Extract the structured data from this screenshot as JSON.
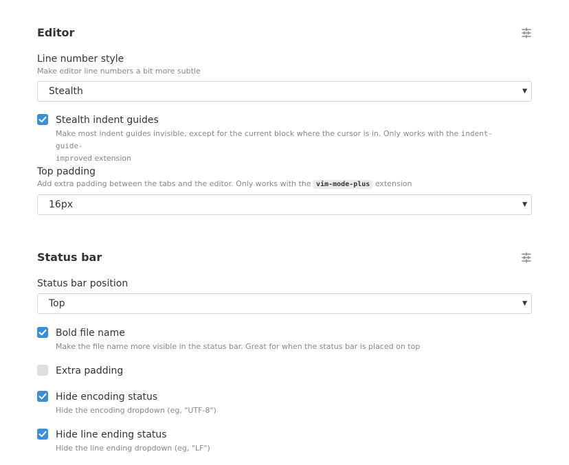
{
  "editor": {
    "title": "Editor",
    "icon": "settings-sliders-icon",
    "line_number_style": {
      "label": "Line number style",
      "description": "Make editor line numbers a bit more subtle",
      "value": "Stealth"
    },
    "stealth_indent_guides": {
      "label": "Stealth indent guides",
      "checked": true,
      "description_before": "Make most indent guides invisible, except for the current block where the cursor is in. Only works with the ",
      "code_a": "indent-guide-",
      "code_b": "improved",
      "description_after": " extension"
    },
    "top_padding": {
      "label": "Top padding",
      "description_before": "Add extra padding between the tabs and the editor. Only works with the ",
      "code": "vim-mode-plus",
      "description_after": " extension",
      "value": "16px"
    }
  },
  "status_bar": {
    "title": "Status bar",
    "icon": "settings-sliders-icon",
    "position": {
      "label": "Status bar position",
      "value": "Top"
    },
    "bold_file_name": {
      "label": "Bold file name",
      "checked": true,
      "description": "Make the file name more visible in the status bar. Great for when the status bar is placed on top"
    },
    "extra_padding": {
      "label": "Extra padding",
      "checked": false
    },
    "hide_encoding_status": {
      "label": "Hide encoding status",
      "checked": true,
      "description": "Hide the encoding dropdown (eg, \"UTF-8\")"
    },
    "hide_line_ending_status": {
      "label": "Hide line ending status",
      "checked": true,
      "description": "Hide the line ending dropdown (eg, \"LF\")"
    }
  },
  "colors": {
    "checkbox_on": "#3b8fd9",
    "checkbox_off": "#dedede",
    "description_text": "#888888"
  }
}
